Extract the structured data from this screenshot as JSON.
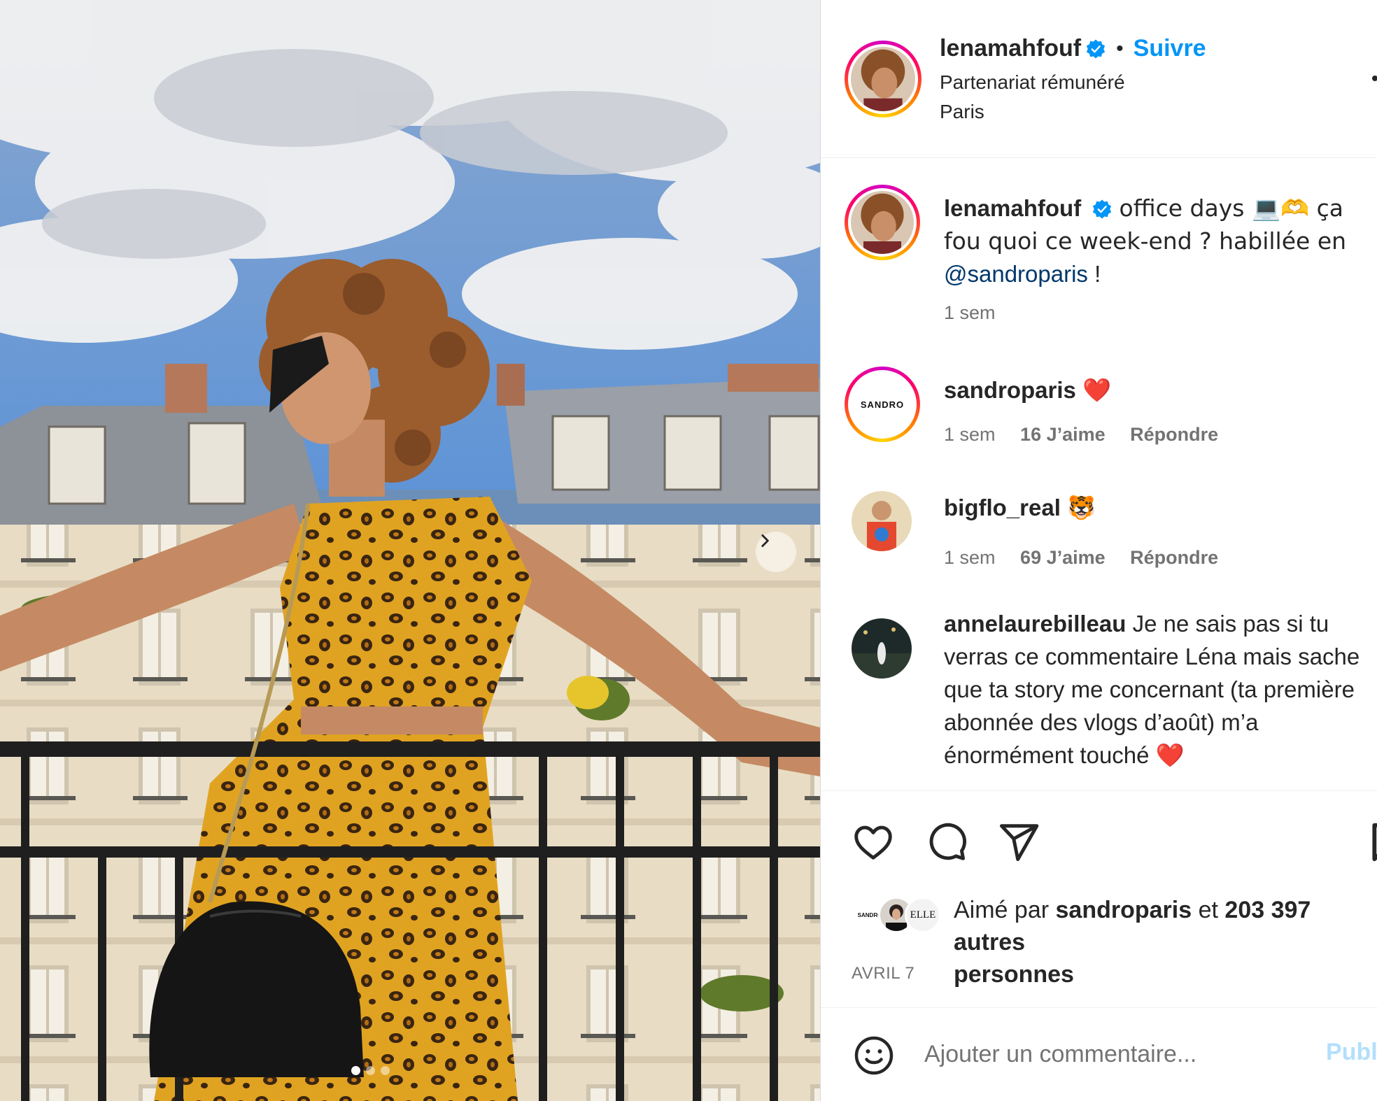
{
  "post": {
    "username": "lenamahfouf",
    "follow_label": "Suivre",
    "separator": "•",
    "partnership_label": "Partenariat rémunéré",
    "location": "Paris",
    "caption": {
      "text_part1": "office days 💻🫶 ça fou quoi ce week-end ? habillée en",
      "mention": "@sandroparis",
      "text_part2": "!",
      "age": "1 sem"
    },
    "carousel": {
      "total": 3,
      "active_index": 0
    }
  },
  "comments": [
    {
      "username": "sandroparis",
      "text": "❤️",
      "avatar_label": "SANDRO",
      "age": "1 sem",
      "likes": "16 J’aime",
      "reply_label": "Répondre"
    },
    {
      "username": "bigflo_real",
      "text": "🐯",
      "age": "1 sem",
      "likes": "69 J’aime",
      "reply_label": "Répondre"
    },
    {
      "username": "annelaurebilleau",
      "text": "Je ne sais pas si tu verras ce commentaire Léna mais sache que ta story me concernant (ta première abonnée des vlogs d’août) m’a énormément touché",
      "text_emoji": "❤️"
    }
  ],
  "likes": {
    "prefix": "Aimé par",
    "first_liker": "sandroparis",
    "connector": "et",
    "others": "203 397 autres",
    "suffix": "personnes",
    "liker_avatar_labels": [
      "SANDRO",
      "ELLE"
    ]
  },
  "date": "AVRIL 7",
  "add_comment": {
    "placeholder": "Ajouter un commentaire...",
    "publish_label": "Publier"
  },
  "colors": {
    "accent": "#0095f6",
    "text": "#262626",
    "secondary": "#737373",
    "heart": "#ed4956",
    "verified": "#0095f6"
  },
  "icons": [
    "heart-icon",
    "comment-icon",
    "share-icon",
    "bookmark-icon",
    "emoji-icon",
    "verified-icon",
    "chevron-right-icon",
    "more-options-icon"
  ]
}
